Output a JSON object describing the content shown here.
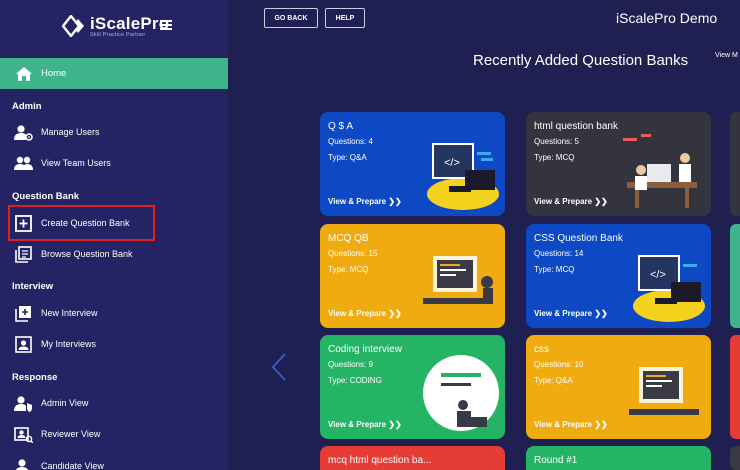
{
  "brand": {
    "name": "iScalePro",
    "tagline": "Skill Practice Partner"
  },
  "sidebar": {
    "home": "Home",
    "sections": [
      {
        "title": "Admin",
        "items": [
          "Manage Users",
          "View Team Users"
        ]
      },
      {
        "title": "Question Bank",
        "items": [
          "Create Question Bank",
          "Browse Question Bank"
        ]
      },
      {
        "title": "Interview",
        "items": [
          "New Interview",
          "My Interviews"
        ]
      },
      {
        "title": "Response",
        "items": [
          "Admin View",
          "Reviewer View",
          "Candidate View"
        ]
      }
    ]
  },
  "topbar": {
    "go_back": "GO BACK",
    "help": "HELP",
    "app_title": "iScalePro Demo"
  },
  "main": {
    "section_title": "Recently Added Question Banks",
    "view_more": "View M",
    "cards": [
      {
        "title": "Q $ A",
        "questions": "Questions: 4",
        "type": "Type: Q&A",
        "action": "View & Prepare",
        "color": "#0d49c4"
      },
      {
        "title": "html question bank",
        "questions": "Questions: 5",
        "type": "Type: MCQ",
        "action": "View & Prepare",
        "color": "#34343e"
      },
      {
        "title": "MCQ QB",
        "questions": "Questions: 15",
        "type": "Type: MCQ",
        "action": "View & Prepare",
        "color": "#f0ab10"
      },
      {
        "title": "CSS Question Bank",
        "questions": "Questions: 14",
        "type": "Type: MCQ",
        "action": "View & Prepare",
        "color": "#0d49c4"
      },
      {
        "title": "Coding interview",
        "questions": "Questions: 9",
        "type": "Type: CODING",
        "action": "View & Prepare",
        "color": "#25b365"
      },
      {
        "title": "css",
        "questions": "Questions: 10",
        "type": "Type: Q&A",
        "action": "View & Prepare",
        "color": "#f0ab10"
      },
      {
        "title": "mcq html question ba...",
        "color": "#e53d36"
      },
      {
        "title": "Round #1",
        "color": "#25b365"
      }
    ]
  },
  "colors": {
    "sidebar": "#242464",
    "background": "#1f1f52",
    "active": "#3fb389",
    "highlight": "#e02020"
  }
}
